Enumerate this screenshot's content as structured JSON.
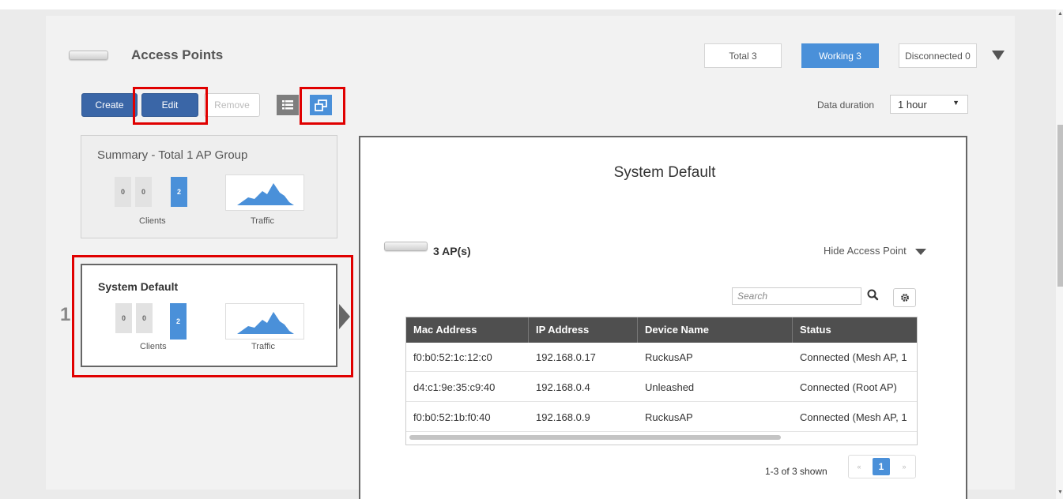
{
  "header": {
    "title": "Access Points",
    "stats": {
      "total": "Total 3",
      "working": "Working 3",
      "disconnected": "Disconnected 0"
    }
  },
  "toolbar": {
    "create_label": "Create",
    "edit_label": "Edit",
    "remove_label": "Remove",
    "views": [
      "list-view-icon",
      "tile-view-icon"
    ]
  },
  "data_duration": {
    "label": "Data duration",
    "value": "1 hour"
  },
  "groups": {
    "summary": {
      "title": "Summary - Total 1 AP Group",
      "clients": [
        "0",
        "0",
        "2"
      ],
      "clients_label": "Clients",
      "traffic_label": "Traffic"
    },
    "default": {
      "index": "1",
      "title": "System Default",
      "clients": [
        "0",
        "0",
        "2"
      ],
      "clients_label": "Clients",
      "traffic_label": "Traffic"
    }
  },
  "detail": {
    "title": "System Default",
    "ap_count": "3 AP(s)",
    "hide_label": "Hide Access Point",
    "search_placeholder": "Search",
    "columns": [
      "Mac Address",
      "IP Address",
      "Device Name",
      "Status"
    ],
    "rows": [
      [
        "f0:b0:52:1c:12:c0",
        "192.168.0.17",
        "RuckusAP",
        "Connected (Mesh AP, 1"
      ],
      [
        "d4:c1:9e:35:c9:40",
        "192.168.0.4",
        "Unleashed",
        "Connected (Root AP)"
      ],
      [
        "f0:b0:52:1b:f0:40",
        "192.168.0.9",
        "RuckusAP",
        "Connected (Mesh AP, 1"
      ]
    ],
    "paging": {
      "info": "1-3 of 3 shown",
      "prev": "«",
      "current": "1",
      "next": "»"
    }
  },
  "colors": {
    "accent": "#4a90d9",
    "primary_button": "#3a66a7",
    "highlight": "#e00000",
    "table_header": "#4f4f4f"
  }
}
